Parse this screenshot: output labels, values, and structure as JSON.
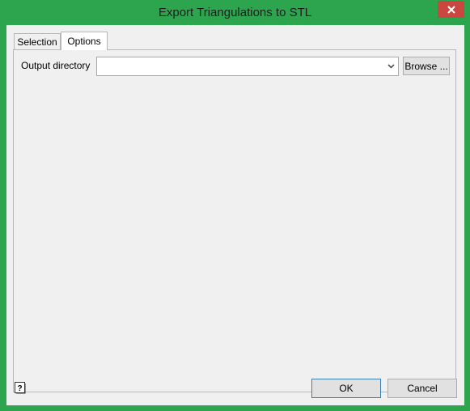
{
  "window": {
    "title": "Export Triangulations to STL",
    "accent_color": "#2da44e",
    "close_icon": "close-icon"
  },
  "tabs": [
    {
      "label": "Selection",
      "selected": false
    },
    {
      "label": "Options",
      "selected": true
    }
  ],
  "options": {
    "output_directory_label": "Output directory",
    "output_directory_value": "",
    "browse_label": "Browse ..."
  },
  "footer": {
    "help_icon": "help-icon",
    "ok_label": "OK",
    "cancel_label": "Cancel"
  }
}
